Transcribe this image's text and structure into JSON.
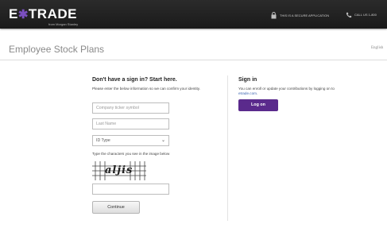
{
  "header": {
    "logo_text": "E*TRADE",
    "logo_subtitle": "from Morgan Stanley",
    "secure_text": "THIS IS A SECURE APPLICATION",
    "call_text": "CALL US 1-800"
  },
  "page": {
    "title": "Employee Stock Plans",
    "language": "English"
  },
  "start_form": {
    "heading": "Don't have a sign in? Start here.",
    "intro": "Please enter the below information so we can confirm your identity.",
    "company_placeholder": "Company ticker symbol",
    "lastname_placeholder": "Last Name",
    "id_type_selected": "ID Type",
    "captcha_label": "Type the characters you see in the image below",
    "captcha_text": "aljis",
    "continue_label": "Continue"
  },
  "signin": {
    "heading": "Sign in",
    "text_before_link": "You can enroll or update your contributions by logging on to ",
    "link_text": "etrade.com",
    "text_after_link": ".",
    "logon_label": "Log on"
  },
  "colors": {
    "header_bg": "#1f1f1f",
    "logon_button": "#5a2a8c",
    "link": "#3b64b0"
  }
}
